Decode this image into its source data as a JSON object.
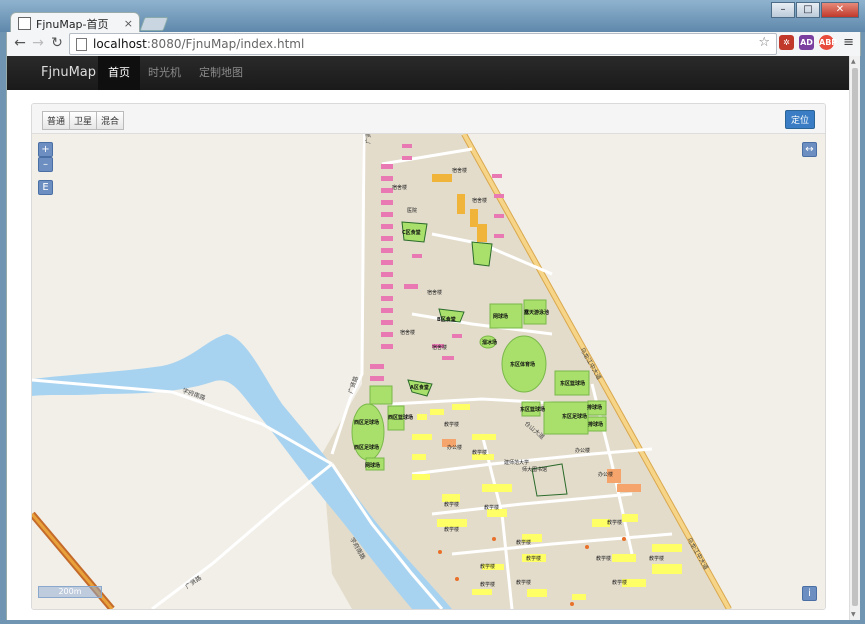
{
  "browser": {
    "tab_title": "FjnuMap-首页",
    "tab_close": "×",
    "url_host": "localhost",
    "url_path": ":8080/FjnuMap/index.html",
    "window_controls": [
      "–",
      "□",
      "✕"
    ]
  },
  "navbar": {
    "brand": "FjnuMap",
    "items": [
      "首页",
      "时光机",
      "定制地图"
    ],
    "active_index": 0
  },
  "panel": {
    "map_types": [
      "普通",
      "卫星",
      "混合"
    ],
    "locate_label": "定位"
  },
  "map_controls": {
    "zoom_in": "+",
    "zoom_out": "–",
    "layer_switch": "E",
    "expand": "↔",
    "info": "i",
    "scale": "200m"
  },
  "map": {
    "roads": {
      "east_avenue": "乌龙江中大道",
      "west_road": "广贤路",
      "south_road_a": "学府南路",
      "south_road_b": "学府南路",
      "bottom_road": "广贤路",
      "inner_road": "仓山大道"
    },
    "canteens": [
      "C区食堂",
      "B区食堂",
      "A区食堂"
    ],
    "dorm_label": "宿舍楼",
    "hospital": "医院",
    "sports": {
      "volleyball": "网球场",
      "pool": "露天游泳池",
      "skating": "溜冰场",
      "gym": "东区体育场",
      "basket_east": "东区篮球场",
      "soccer_east": "东区足球场",
      "tennis": "排球场",
      "west_soccer": "西区足球场",
      "west_basket": "西区篮球场"
    },
    "teaching": "教学楼",
    "library": "师大图书馆",
    "office": "办公楼",
    "library_prefix": "建师范大学"
  },
  "colors": {
    "navbar_bg": "#1b1b1b",
    "primary": "#3a7dc4",
    "campus": "#e3dccb",
    "dorm": "#e879b3",
    "teaching": "#ffff66",
    "sport": "#a8e06b",
    "water": "#a8d3f0",
    "avenue": "#f2c26b"
  }
}
